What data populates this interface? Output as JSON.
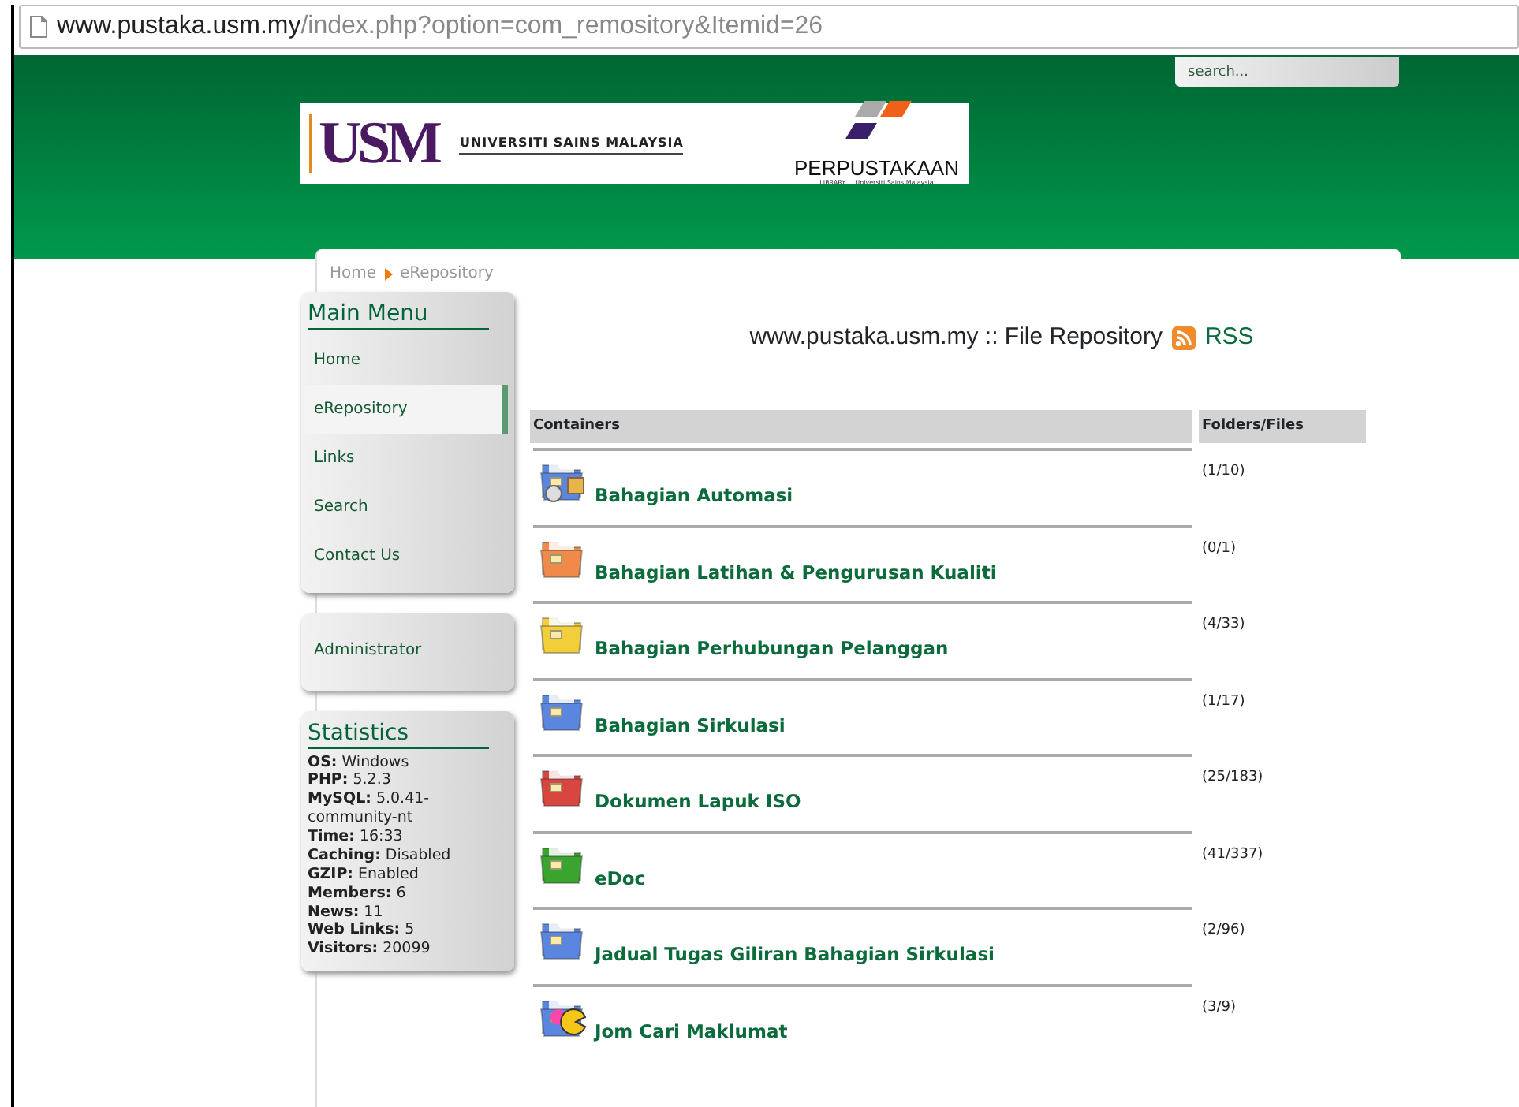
{
  "browser": {
    "url_host": "www.pustaka.usm.my",
    "url_path": "/index.php?option=com_remository&Itemid=26"
  },
  "header": {
    "search": {
      "placeholder": "search..."
    },
    "logo": {
      "usm": "USM",
      "university": "UNIVERSITI SAINS MALAYSIA",
      "library": "PERPUSTAKAAN",
      "library_sub": "LIBRARY",
      "library_university": "Universiti Sains Malaysia"
    }
  },
  "breadcrumb": [
    "Home",
    "eRepository"
  ],
  "main_menu": {
    "title": "Main Menu",
    "items": [
      {
        "label": "Home",
        "selected": false
      },
      {
        "label": "eRepository",
        "selected": true
      },
      {
        "label": "Links",
        "selected": false
      },
      {
        "label": "Search",
        "selected": false
      },
      {
        "label": "Contact Us",
        "selected": false
      }
    ]
  },
  "admin_menu": {
    "items": [
      {
        "label": "Administrator",
        "selected": false
      }
    ]
  },
  "statistics": {
    "title": "Statistics",
    "lines": [
      "**OS:** Windows",
      "**PHP:** 5.2.3",
      "**MySQL:** 5.0.41-community-nt",
      "**Time:** 16:33",
      "**Caching:** Disabled",
      "**GZIP:** Enabled",
      "**Members:** 6",
      "**News:** 11",
      "**Web Links:** 5",
      "**Visitors:** 20099"
    ]
  },
  "repository": {
    "title": "www.pustaka.usm.my :: File Repository",
    "rss": "RSS",
    "table": {
      "columns": [
        "Containers",
        "Folders/Files"
      ],
      "rows": [
        {
          "name": "Bahagian Automasi",
          "count": "(1/10)",
          "kind": "program",
          "color": "#5b86e0"
        },
        {
          "name": "Bahagian Latihan & Pengurusan Kualiti",
          "count": "(0/1)",
          "kind": "folder",
          "color": "#f08a4b"
        },
        {
          "name": "Bahagian Perhubungan Pelanggan",
          "count": "(4/33)",
          "kind": "folder",
          "color": "#f2cf3a"
        },
        {
          "name": "Bahagian Sirkulasi",
          "count": "(1/17)",
          "kind": "folder",
          "color": "#5b86e0"
        },
        {
          "name": "Dokumen Lapuk ISO",
          "count": "(25/183)",
          "kind": "folder",
          "color": "#d9453f"
        },
        {
          "name": "eDoc",
          "count": "(41/337)",
          "kind": "folder",
          "color": "#3aa52e"
        },
        {
          "name": "Jadual Tugas Giliran Bahagian Sirkulasi",
          "count": "(2/96)",
          "kind": "folder",
          "color": "#5b86e0"
        },
        {
          "name": "Jom Cari Maklumat",
          "count": "(3/9)",
          "kind": "game",
          "color": "#5b86e0"
        }
      ]
    }
  }
}
